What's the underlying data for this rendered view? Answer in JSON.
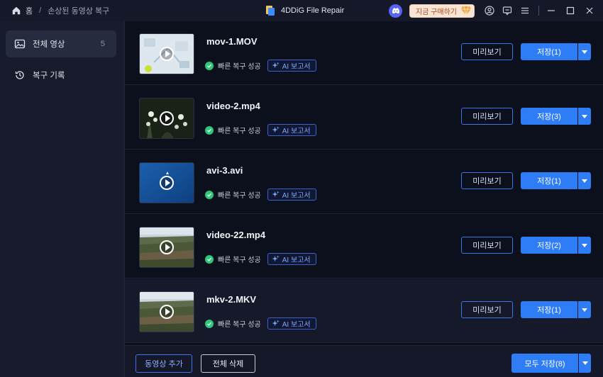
{
  "titlebar": {
    "breadcrumb_home": "홈",
    "breadcrumb_sep": "/",
    "breadcrumb_current": "손상된 동영상 복구",
    "app_title": "4DDiG File Repair",
    "buy_label": "지금 구매하기"
  },
  "sidebar": {
    "items": [
      {
        "label": "전체 영상",
        "count": "5"
      },
      {
        "label": "복구 기록"
      }
    ]
  },
  "files": [
    {
      "name": "mov-1.MOV",
      "status": "빠른 복구 성공",
      "ai_label": "AI 보고서",
      "preview_label": "미리보기",
      "save_label": "저장(1)"
    },
    {
      "name": "video-2.mp4",
      "status": "빠른 복구 성공",
      "ai_label": "AI 보고서",
      "preview_label": "미리보기",
      "save_label": "저장(3)"
    },
    {
      "name": "avi-3.avi",
      "status": "빠른 복구 성공",
      "ai_label": "AI 보고서",
      "preview_label": "미리보기",
      "save_label": "저장(1)"
    },
    {
      "name": "video-22.mp4",
      "status": "빠른 복구 성공",
      "ai_label": "AI 보고서",
      "preview_label": "미리보기",
      "save_label": "저장(2)"
    },
    {
      "name": "mkv-2.MKV",
      "status": "빠른 복구 성공",
      "ai_label": "AI 보고서",
      "preview_label": "미리보기",
      "save_label": "저장(1)"
    }
  ],
  "bottom": {
    "add_label": "동영상 추가",
    "delete_label": "전체 삭제",
    "save_all_label": "모두 저장(8)"
  },
  "colors": {
    "accent": "#2f7df6",
    "success": "#2fc77a",
    "background": "#0c0f1c",
    "sidebar": "#171b2b"
  }
}
